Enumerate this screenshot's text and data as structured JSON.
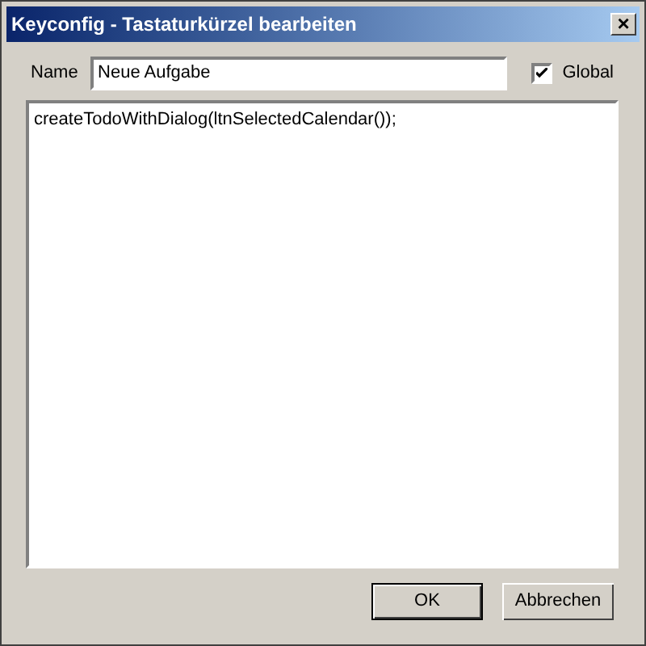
{
  "window": {
    "title": "Keyconfig - Tastaturkürzel bearbeiten",
    "close": "×"
  },
  "name_field": {
    "label": "Name",
    "value": "Neue Aufgabe"
  },
  "global": {
    "label": "Global",
    "checked": true
  },
  "code": {
    "value": "createTodoWithDialog(ltnSelectedCalendar());"
  },
  "buttons": [
    {
      "label": "OK",
      "default": true
    },
    {
      "label": "Abbrechen",
      "default": false
    }
  ]
}
